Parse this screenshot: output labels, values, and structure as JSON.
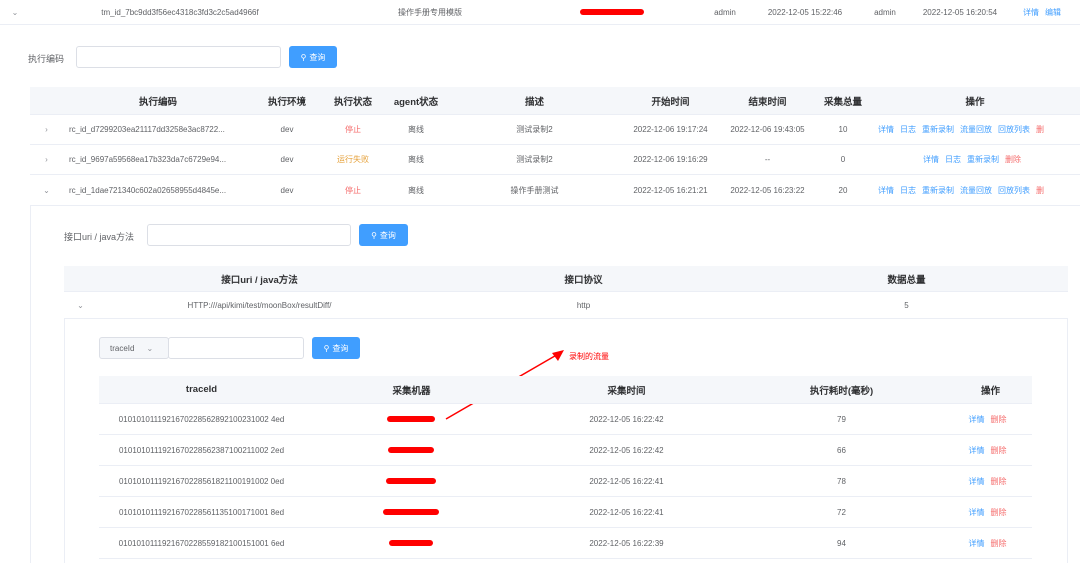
{
  "top_row": {
    "id": "tm_id_7bc9dd3f56ec4318c3fd3c2c5ad4966f",
    "template": "操作手册专用模版",
    "creator": "admin",
    "created": "2022-12-05 15:22:46",
    "modifier": "admin",
    "modified": "2022-12-05 16:20:54",
    "actions": [
      "详情",
      "编辑"
    ]
  },
  "search": {
    "label": "执行编码",
    "button": "查询"
  },
  "main_table": {
    "headers": [
      "执行编码",
      "执行环境",
      "执行状态",
      "agent状态",
      "描述",
      "开始时间",
      "结束时间",
      "采集总量",
      "操作"
    ],
    "rows": [
      {
        "code": "rc_id_d7299203ea21117dd3258e3ac8722...",
        "env": "dev",
        "status": "停止",
        "agent": "离线",
        "desc": "测试录制2",
        "start": "2022-12-06 19:17:24",
        "end": "2022-12-06 19:43:05",
        "total": "10",
        "actions": [
          "详情",
          "日志",
          "重新录制",
          "流量回放",
          "回放列表",
          "删"
        ]
      },
      {
        "code": "rc_id_9697a59568ea17b323da7c6729e94...",
        "env": "dev",
        "status": "运行失败",
        "agent": "离线",
        "desc": "测试录制2",
        "start": "2022-12-06 19:16:29",
        "end": "--",
        "total": "0",
        "actions": [
          "详情",
          "日志",
          "重新录制",
          "删除"
        ]
      },
      {
        "code": "rc_id_1dae721340c602a02658955d4845e...",
        "env": "dev",
        "status": "停止",
        "agent": "离线",
        "desc": "操作手册测试",
        "start": "2022-12-05 16:21:21",
        "end": "2022-12-05 16:23:22",
        "total": "20",
        "actions": [
          "详情",
          "日志",
          "重新录制",
          "流量回放",
          "回放列表",
          "删"
        ]
      }
    ]
  },
  "sub_search": {
    "label": "接口uri / java方法",
    "button": "查询"
  },
  "interface_table": {
    "headers": [
      "接口uri / java方法",
      "接口协议",
      "数据总量"
    ],
    "row": {
      "uri": "HTTP:///api/kimi/test/moonBox/resultDiff/",
      "protocol": "http",
      "total": "5"
    }
  },
  "trace_search": {
    "select_value": "traceId",
    "button": "查询"
  },
  "annotation": "录制的流量",
  "trace_table": {
    "headers": [
      "traceId",
      "采集机器",
      "采集时间",
      "执行耗时(毫秒)",
      "操作"
    ],
    "rows": [
      {
        "trace": "0101010111921670228562892100231002 4ed",
        "time": "2022-12-05 16:22:42",
        "cost": "79"
      },
      {
        "trace": "0101010111921670228562387100211002 2ed",
        "time": "2022-12-05 16:22:42",
        "cost": "66"
      },
      {
        "trace": "0101010111921670228561821100191002 0ed",
        "time": "2022-12-05 16:22:41",
        "cost": "78"
      },
      {
        "trace": "0101010111921670228561135100171001 8ed",
        "time": "2022-12-05 16:22:41",
        "cost": "72"
      },
      {
        "trace": "0101010111921670228559182100151001 6ed",
        "time": "2022-12-05 16:22:39",
        "cost": "94"
      }
    ],
    "actions": [
      "详情",
      "删除"
    ]
  },
  "colors": {
    "primary": "#409eff",
    "danger": "#f56c6c",
    "warning": "#e6a23c",
    "redact": "#ff0000"
  }
}
